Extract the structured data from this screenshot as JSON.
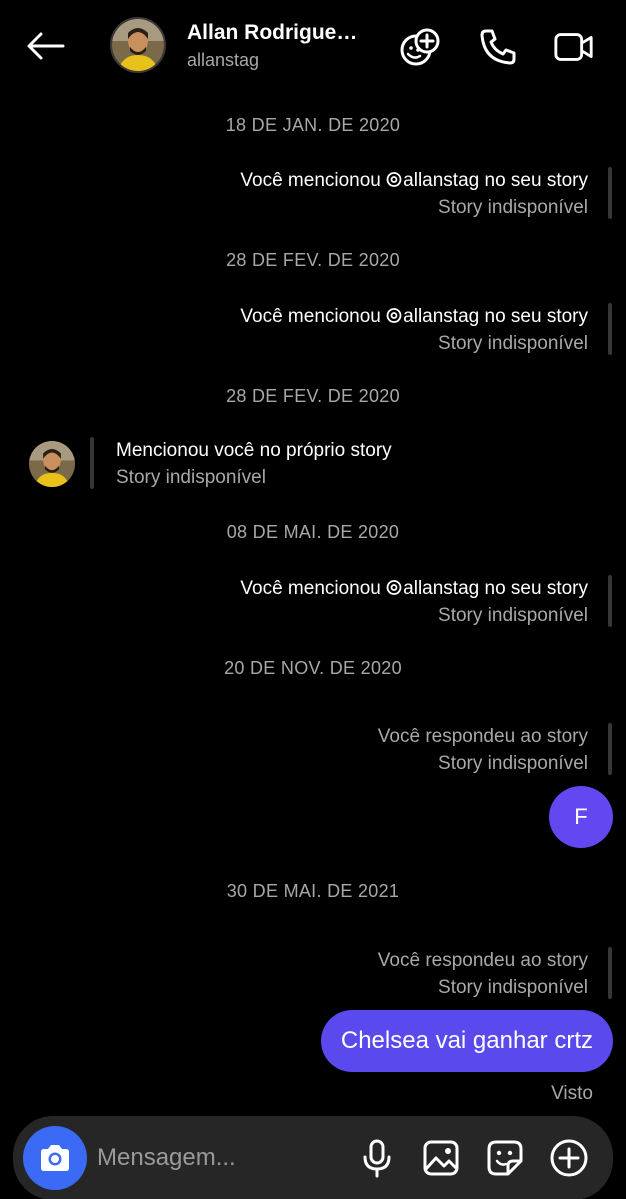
{
  "header": {
    "name": "Allan Rodrigue…",
    "username": "allanstag",
    "icons": [
      "back-arrow-icon",
      "avatar",
      "add-video-call-icon",
      "phone-icon",
      "video-camera-icon"
    ]
  },
  "dates": [
    "18 DE JAN. DE 2020",
    "28 DE FEV. DE 2020",
    "28 DE FEV. DE 2020",
    "08 DE MAI. DE 2020",
    "20 DE NOV. DE 2020",
    "30 DE MAI. DE 2021"
  ],
  "mentions": {
    "prefix": "Você mencionou ",
    "handle": "allanstag",
    "suffix": " no seu story",
    "unavailable": "Story indisponível"
  },
  "incoming": {
    "text": "Mencionou você no próprio story",
    "unavailable": "Story indisponível"
  },
  "replies": {
    "text": "Você respondeu ao story",
    "unavailable": "Story indisponível"
  },
  "messages": {
    "reaction": "F",
    "text": "Chelsea vai ganhar crtz",
    "seen": "Visto"
  },
  "composer": {
    "placeholder": "Mensagem...",
    "icons": [
      "camera-icon",
      "microphone-icon",
      "gallery-icon",
      "sticker-icon",
      "plus-icon"
    ]
  },
  "colors": {
    "background": "#000000",
    "bubble": "#5a49ec",
    "camera_button": "#3b6bf5",
    "muted_text": "#a8a8a8"
  }
}
